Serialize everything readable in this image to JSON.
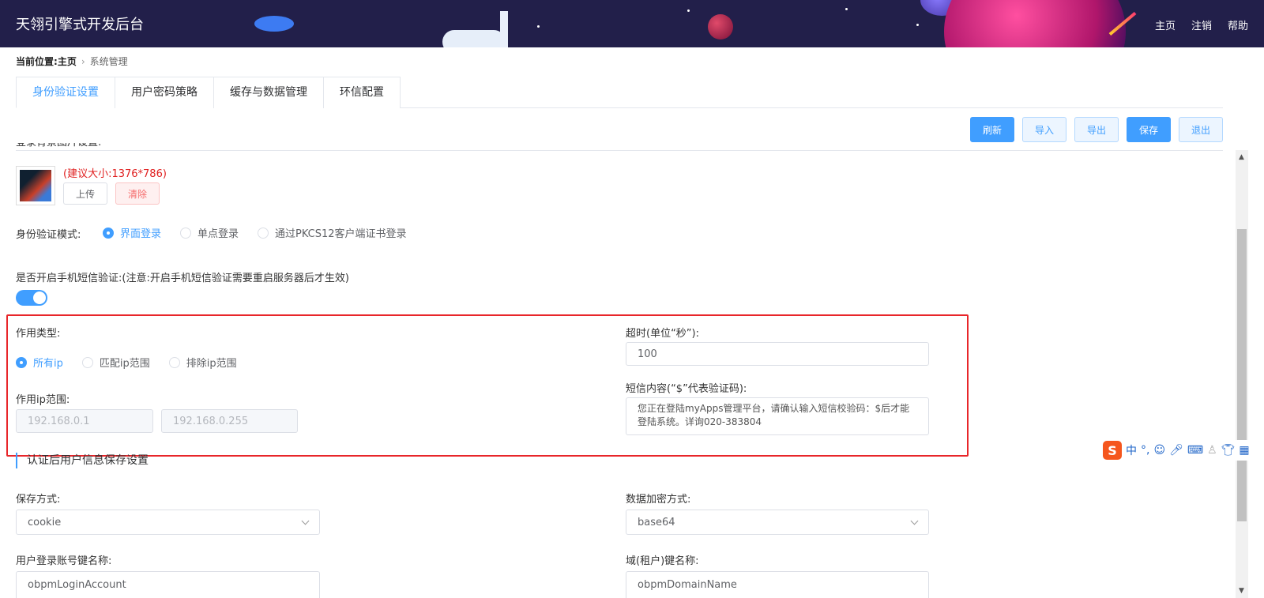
{
  "header": {
    "title": "天翎引擎式开发后台",
    "nav": [
      "主页",
      "注销",
      "帮助"
    ]
  },
  "breadcrumb": {
    "prefix": "当前位置:",
    "home": "主页",
    "separator": "›",
    "current": "系统管理"
  },
  "tabs": [
    {
      "label": "身份验证设置",
      "active": true
    },
    {
      "label": "用户密码策略",
      "active": false
    },
    {
      "label": "缓存与数据管理",
      "active": false
    },
    {
      "label": "环信配置",
      "active": false
    }
  ],
  "toolbar": {
    "refresh": "刷新",
    "import": "导入",
    "export": "导出",
    "save": "保存",
    "exit": "退出"
  },
  "login_bg": {
    "label": "登录背景图片设置:",
    "hint": "(建议大小:1376*786)",
    "upload": "上传",
    "clear": "清除"
  },
  "auth_mode": {
    "label": "身份验证模式:",
    "options": [
      "界面登录",
      "单点登录",
      "通过PKCS12客户端证书登录"
    ],
    "selected": "界面登录"
  },
  "sms": {
    "label": "是否开启手机短信验证:(注意:开启手机短信验证需要重启服务器后才生效)",
    "enabled": true,
    "scope_label": "作用类型:",
    "scope_options": [
      "所有ip",
      "匹配ip范围",
      "排除ip范围"
    ],
    "scope_selected": "所有ip",
    "ip_range_label": "作用ip范围:",
    "ip_start_placeholder": "192.168.0.1",
    "ip_end_placeholder": "192.168.0.255",
    "timeout_label": "超时(单位“秒”):",
    "timeout_value": "100",
    "content_label": "短信内容(“$”代表验证码):",
    "content_value": "您正在登陆myApps管理平台，请确认输入短信校验码：$后才能登陆系统。详询020-383804"
  },
  "user_info": {
    "section_title": "认证后用户信息保存设置",
    "save_method_label": "保存方式:",
    "save_method_value": "cookie",
    "encrypt_label": "数据加密方式:",
    "encrypt_value": "base64",
    "account_key_label": "用户登录账号键名称:",
    "account_key_value": "obpmLoginAccount",
    "domain_key_label": "域(租户)键名称:",
    "domain_key_value": "obpmDomainName"
  },
  "ime": {
    "logo": "S",
    "lang": "中",
    "punct": "°,"
  },
  "colors": {
    "primary": "#409eff",
    "header_bg": "#221f4a",
    "highlight_border": "#e8262a",
    "hint_red": "#e02020"
  }
}
